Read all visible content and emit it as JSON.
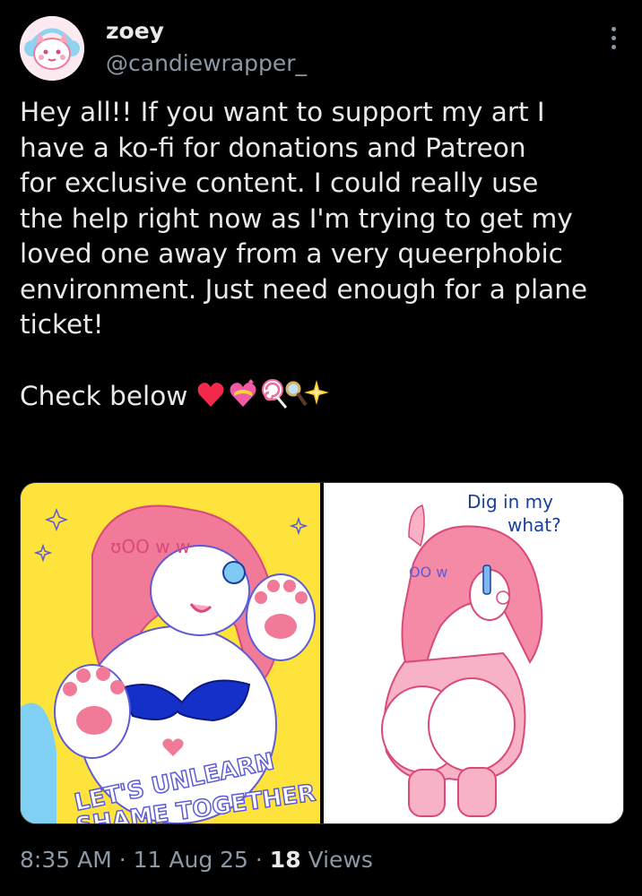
{
  "author": {
    "display_name": "zoey",
    "handle": "@candiewrapper_"
  },
  "tweet": {
    "text": "Hey all!! If you want to support my art I\nhave a ko-fi for donations and Patreon\nfor exclusive content. I could really use\nthe help right now as I'm trying to get my\nloved one away from a very queerphobic\nenvironment. Just need enough for a plane\nticket!\n\n",
    "check_below": "Check below ",
    "emojis": [
      "heart-emoji",
      "heart-ribbon-emoji",
      "lollipop-emoji",
      "magnifier-emoji",
      "sparkle-emoji"
    ]
  },
  "media": {
    "left_caption_line1": "LET'S UNLEARN",
    "left_caption_line2": "SHAME TOGETHER",
    "left_sfx": "ʊOO w   w",
    "right_speech_line1": "Dig in my",
    "right_speech_line2": "what?",
    "right_sfx": "OO w",
    "colors": {
      "left_bg": "#fde33b",
      "right_bg": "#ffffff",
      "character_pink": "#f07a97"
    }
  },
  "meta": {
    "time": "8:35 AM",
    "date": "11 Aug 25",
    "views_count": "18",
    "views_label": "Views",
    "sep": " · "
  }
}
